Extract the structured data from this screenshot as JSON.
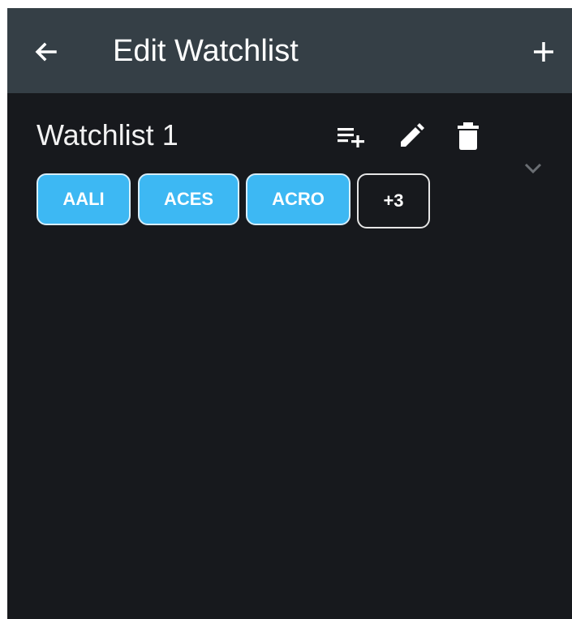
{
  "header": {
    "title": "Edit Watchlist",
    "back_icon": "arrow-left-icon",
    "add_icon": "plus-icon"
  },
  "watchlist": {
    "name": "Watchlist 1",
    "actions": {
      "add_to_list_icon": "playlist-add-icon",
      "edit_icon": "pencil-icon",
      "delete_icon": "trash-icon",
      "expand_icon": "chevron-down-icon"
    },
    "symbols": [
      "AALI",
      "ACES",
      "ACRO"
    ],
    "more_label": "+3"
  },
  "colors": {
    "appbar": "#353f46",
    "background": "#17191d",
    "chip": "#3db8f3",
    "text": "#ffffff"
  }
}
